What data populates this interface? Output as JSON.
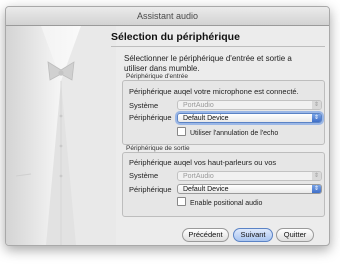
{
  "window": {
    "title": "Assistant audio"
  },
  "page": {
    "title": "Sélection du périphérique",
    "intro": "Sélectionner le périphérique d'entrée et sortie a utiliser dans mumble."
  },
  "input_group": {
    "label": "Périphérique d'entrée",
    "description": "Périphérique auqel votre microphone est connecté.",
    "system_label": "Système",
    "system_value": "PortAudio",
    "device_label": "Périphérique",
    "device_value": "Default Device",
    "checkbox_label": "Utiliser l'annulation de l'echo"
  },
  "output_group": {
    "label": "Périphérique de sortie",
    "description": "Périphérique auqel vos haut-parleurs ou vos",
    "system_label": "Système",
    "system_value": "PortAudio",
    "device_label": "Périphérique",
    "device_value": "Default Device",
    "checkbox_label": "Enable positional audio"
  },
  "buttons": {
    "previous": "Précédent",
    "next": "Suivant",
    "quit": "Quitter"
  }
}
